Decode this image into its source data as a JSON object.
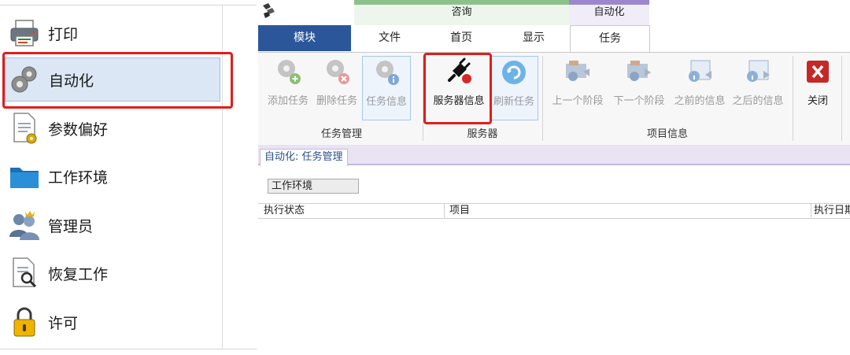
{
  "left_menu": {
    "items": [
      {
        "label": "打印",
        "icon": "printer-icon"
      },
      {
        "label": "自动化",
        "icon": "gears-icon",
        "selected": true
      },
      {
        "label": "参数偏好",
        "icon": "preferences-doc-icon"
      },
      {
        "label": "工作环境",
        "icon": "folder-icon"
      },
      {
        "label": "管理员",
        "icon": "admin-users-icon"
      },
      {
        "label": "恢复工作",
        "icon": "restore-search-icon"
      },
      {
        "label": "许可",
        "icon": "lock-icon"
      }
    ]
  },
  "ribbon": {
    "context_groups": {
      "consult": "咨询",
      "automation": "自动化"
    },
    "tabs": {
      "module": "模块",
      "file": "文件",
      "home": "首页",
      "display": "显示",
      "task": "任务"
    },
    "groups": {
      "task_mgmt": {
        "label": "任务管理",
        "buttons": {
          "add_task": "添加任务",
          "delete_task": "删除任务",
          "task_info": "任务信息"
        }
      },
      "server": {
        "label": "服务器",
        "buttons": {
          "server_info": "服务器信息",
          "refresh_task": "刷新任务"
        }
      },
      "project_info": {
        "label": "项目信息",
        "buttons": {
          "prev_stage": "上一个阶段",
          "next_stage": "下一个阶段",
          "prev_info": "之前的信息",
          "next_info": "之后的信息"
        }
      },
      "close": {
        "buttons": {
          "close": "关闭"
        }
      }
    }
  },
  "document": {
    "tab_title": "自动化: 任务管理",
    "env_button": "工作环境",
    "columns": {
      "status": "执行状态",
      "project": "项目",
      "date": "执行日期"
    }
  },
  "colors": {
    "accent_blue": "#2b579a",
    "highlight_red": "#e11d1d",
    "context_green": "#8cc28a",
    "context_purple": "#9b88cc"
  }
}
